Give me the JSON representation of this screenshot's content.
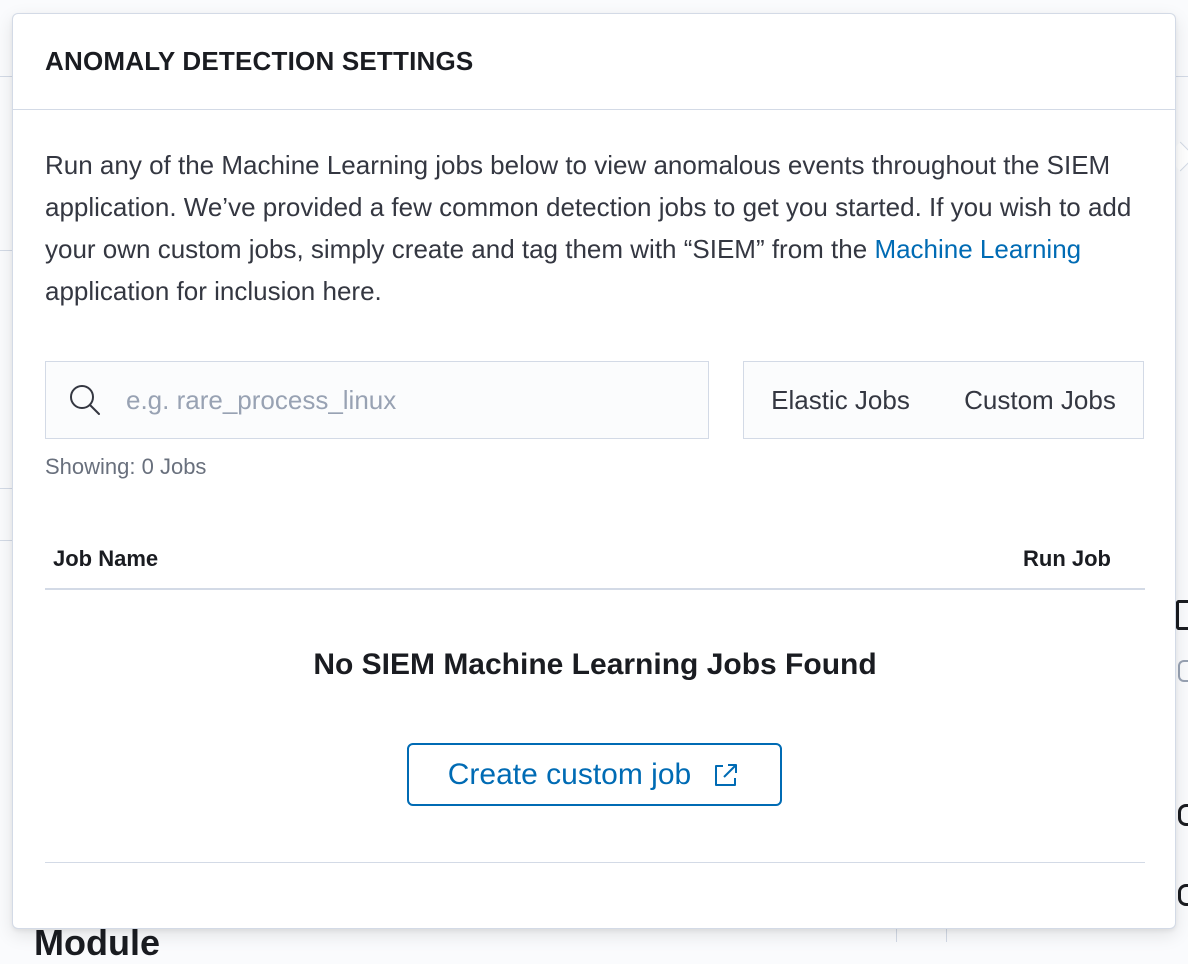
{
  "popover": {
    "title": "ANOMALY DETECTION SETTINGS",
    "description_before_link": "Run any of the Machine Learning jobs below to view anomalous events throughout the SIEM application. We’ve provided a few common detection jobs to get you started. If you wish to add your own custom jobs, simply create and tag them with “SIEM” from the ",
    "description_link": "Machine Learning",
    "description_after_link": " application for inclusion here."
  },
  "search": {
    "placeholder": "e.g. rare_process_linux",
    "value": "",
    "icon": "search-icon"
  },
  "filters": {
    "elastic_jobs": "Elastic Jobs",
    "custom_jobs": "Custom Jobs"
  },
  "showing": "Showing: 0 Jobs",
  "table": {
    "columns": [
      "Job Name",
      "Run Job"
    ]
  },
  "empty_state": {
    "title": "No SIEM Machine Learning Jobs Found",
    "button_label": "Create custom job",
    "button_icon": "external-link-icon"
  },
  "background": {
    "module_label": "Module"
  },
  "colors": {
    "link": "#006bb4",
    "border": "#d3dae6",
    "title": "#1a1c21",
    "muted": "#69707d"
  }
}
